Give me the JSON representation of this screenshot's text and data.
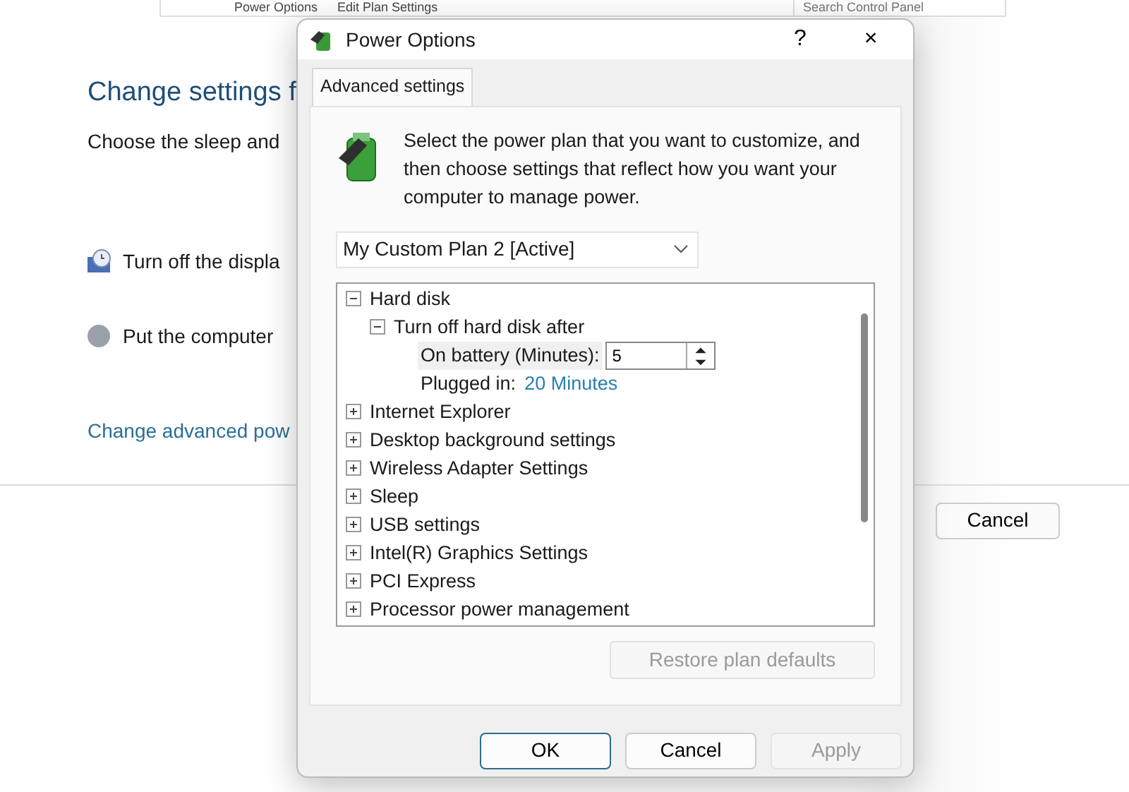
{
  "background_window": {
    "address_bar": {
      "breadcrumbs": [
        "Power Options",
        "Edit Plan Settings"
      ],
      "search": {
        "placeholder": "Search Control Panel"
      }
    },
    "heading": "Change settings f",
    "subtitle": "Choose the sleep and",
    "settings": [
      {
        "kind": "display",
        "label": "Turn off the displa"
      },
      {
        "kind": "sleep",
        "label": "Put the computer"
      }
    ],
    "link": "Change advanced pow",
    "buttons": [
      "Cancel"
    ]
  },
  "dialog": {
    "title": "Power Options",
    "help": "?",
    "close": "×",
    "tabs": [
      {
        "label": "Advanced settings",
        "selected": true
      }
    ],
    "description": "Select the power plan that you want to customize, and then choose settings that reflect how you want your computer to manage power.",
    "plan_select": {
      "value": "My Custom Plan 2 [Active]"
    },
    "tree": [
      {
        "kind": "group",
        "label": "Hard disk",
        "expanded": true,
        "children": [
          {
            "kind": "group",
            "label": "Turn off hard disk after",
            "expanded": true,
            "children": [
              {
                "kind": "spin",
                "label": "On battery (Minutes):",
                "value": "5"
              },
              {
                "kind": "link",
                "label": "Plugged in:",
                "value": "20 Minutes"
              }
            ]
          }
        ]
      },
      {
        "kind": "group",
        "label": "Internet Explorer",
        "expanded": false
      },
      {
        "kind": "group",
        "label": "Desktop background settings",
        "expanded": false
      },
      {
        "kind": "group",
        "label": "Wireless Adapter Settings",
        "expanded": false
      },
      {
        "kind": "group",
        "label": "Sleep",
        "expanded": false
      },
      {
        "kind": "group",
        "label": "USB settings",
        "expanded": false
      },
      {
        "kind": "group",
        "label": "Intel(R) Graphics Settings",
        "expanded": false
      },
      {
        "kind": "group",
        "label": "PCI Express",
        "expanded": false
      },
      {
        "kind": "group",
        "label": "Processor power management",
        "expanded": false
      }
    ],
    "restore_button": {
      "label": "Restore plan defaults",
      "disabled": true
    },
    "buttons": [
      {
        "label": "OK",
        "disabled": false,
        "default": true
      },
      {
        "label": "Cancel",
        "disabled": false,
        "default": false
      },
      {
        "label": "Apply",
        "disabled": true,
        "default": false
      }
    ]
  }
}
